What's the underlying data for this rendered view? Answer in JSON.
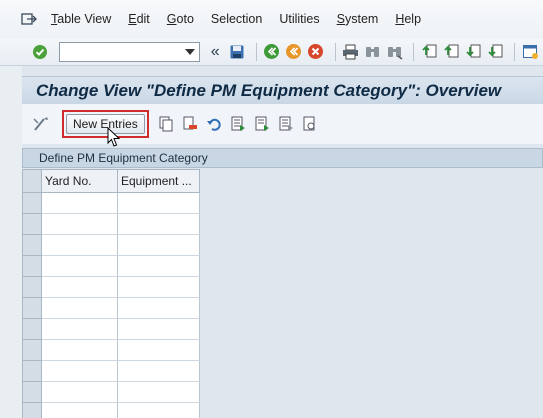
{
  "menubar": {
    "items": [
      {
        "label": "Table View",
        "underline": "T",
        "rest": "able View"
      },
      {
        "label": "Edit",
        "underline": "E",
        "rest": "dit"
      },
      {
        "label": "Goto",
        "underline": "G",
        "rest": "oto"
      },
      {
        "label": "Selection",
        "underline": "",
        "rest": "Selection"
      },
      {
        "label": "Utilities",
        "underline": "",
        "rest": "Utilities"
      },
      {
        "label": "System",
        "underline": "S",
        "rest": "ystem"
      },
      {
        "label": "Help",
        "underline": "H",
        "rest": "elp"
      }
    ]
  },
  "toolbar": {
    "command_field_value": "",
    "prev_symbol": "«"
  },
  "title": "Change View \"Define PM Equipment Category\": Overview",
  "apptoolbar": {
    "new_entries_label": "New Entries"
  },
  "table": {
    "title": "Define PM Equipment Category",
    "columns": [
      "Yard No.",
      "Equipment ..."
    ],
    "row_count": 11
  },
  "colors": {
    "highlight": "#d12c2c",
    "title_text": "#0f2a44"
  }
}
